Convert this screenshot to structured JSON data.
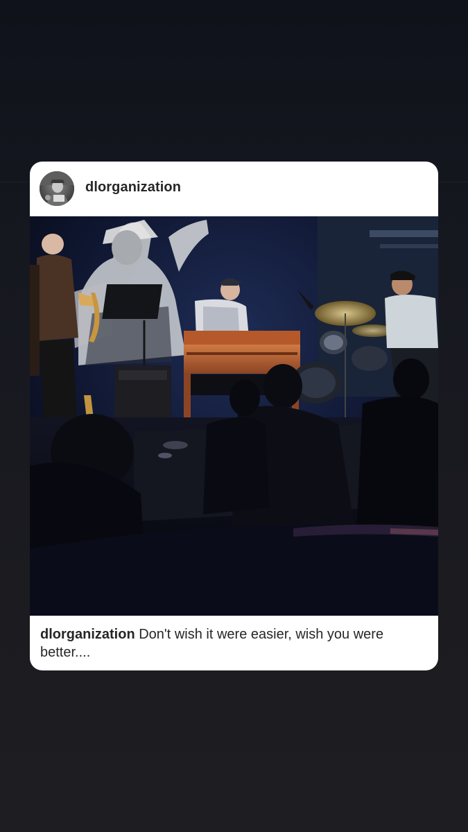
{
  "post": {
    "username": "dlorganization",
    "caption_user": "dlorganization",
    "caption_text": " Don't wish it were easier, wish you were better...."
  },
  "avatar": {
    "icon": "profile-photo-avatar"
  },
  "image": {
    "icon": "concert-photo",
    "accent_colors": [
      "#0c0f1e",
      "#b5592b",
      "#1f3a6e"
    ]
  }
}
